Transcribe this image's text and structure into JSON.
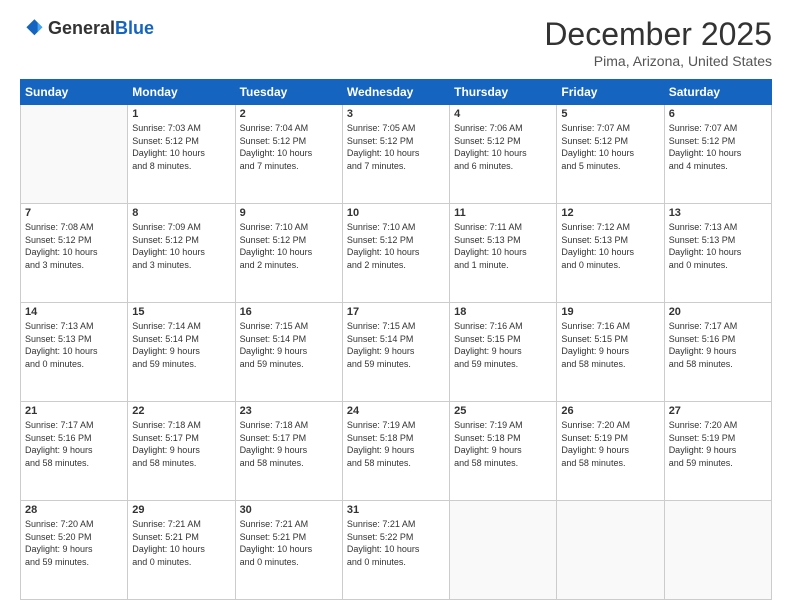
{
  "header": {
    "logo_general": "General",
    "logo_blue": "Blue",
    "month": "December 2025",
    "location": "Pima, Arizona, United States"
  },
  "days_of_week": [
    "Sunday",
    "Monday",
    "Tuesday",
    "Wednesday",
    "Thursday",
    "Friday",
    "Saturday"
  ],
  "weeks": [
    [
      {
        "num": "",
        "info": ""
      },
      {
        "num": "1",
        "info": "Sunrise: 7:03 AM\nSunset: 5:12 PM\nDaylight: 10 hours\nand 8 minutes."
      },
      {
        "num": "2",
        "info": "Sunrise: 7:04 AM\nSunset: 5:12 PM\nDaylight: 10 hours\nand 7 minutes."
      },
      {
        "num": "3",
        "info": "Sunrise: 7:05 AM\nSunset: 5:12 PM\nDaylight: 10 hours\nand 7 minutes."
      },
      {
        "num": "4",
        "info": "Sunrise: 7:06 AM\nSunset: 5:12 PM\nDaylight: 10 hours\nand 6 minutes."
      },
      {
        "num": "5",
        "info": "Sunrise: 7:07 AM\nSunset: 5:12 PM\nDaylight: 10 hours\nand 5 minutes."
      },
      {
        "num": "6",
        "info": "Sunrise: 7:07 AM\nSunset: 5:12 PM\nDaylight: 10 hours\nand 4 minutes."
      }
    ],
    [
      {
        "num": "7",
        "info": "Sunrise: 7:08 AM\nSunset: 5:12 PM\nDaylight: 10 hours\nand 3 minutes."
      },
      {
        "num": "8",
        "info": "Sunrise: 7:09 AM\nSunset: 5:12 PM\nDaylight: 10 hours\nand 3 minutes."
      },
      {
        "num": "9",
        "info": "Sunrise: 7:10 AM\nSunset: 5:12 PM\nDaylight: 10 hours\nand 2 minutes."
      },
      {
        "num": "10",
        "info": "Sunrise: 7:10 AM\nSunset: 5:12 PM\nDaylight: 10 hours\nand 2 minutes."
      },
      {
        "num": "11",
        "info": "Sunrise: 7:11 AM\nSunset: 5:13 PM\nDaylight: 10 hours\nand 1 minute."
      },
      {
        "num": "12",
        "info": "Sunrise: 7:12 AM\nSunset: 5:13 PM\nDaylight: 10 hours\nand 0 minutes."
      },
      {
        "num": "13",
        "info": "Sunrise: 7:13 AM\nSunset: 5:13 PM\nDaylight: 10 hours\nand 0 minutes."
      }
    ],
    [
      {
        "num": "14",
        "info": "Sunrise: 7:13 AM\nSunset: 5:13 PM\nDaylight: 10 hours\nand 0 minutes."
      },
      {
        "num": "15",
        "info": "Sunrise: 7:14 AM\nSunset: 5:14 PM\nDaylight: 9 hours\nand 59 minutes."
      },
      {
        "num": "16",
        "info": "Sunrise: 7:15 AM\nSunset: 5:14 PM\nDaylight: 9 hours\nand 59 minutes."
      },
      {
        "num": "17",
        "info": "Sunrise: 7:15 AM\nSunset: 5:14 PM\nDaylight: 9 hours\nand 59 minutes."
      },
      {
        "num": "18",
        "info": "Sunrise: 7:16 AM\nSunset: 5:15 PM\nDaylight: 9 hours\nand 59 minutes."
      },
      {
        "num": "19",
        "info": "Sunrise: 7:16 AM\nSunset: 5:15 PM\nDaylight: 9 hours\nand 58 minutes."
      },
      {
        "num": "20",
        "info": "Sunrise: 7:17 AM\nSunset: 5:16 PM\nDaylight: 9 hours\nand 58 minutes."
      }
    ],
    [
      {
        "num": "21",
        "info": "Sunrise: 7:17 AM\nSunset: 5:16 PM\nDaylight: 9 hours\nand 58 minutes."
      },
      {
        "num": "22",
        "info": "Sunrise: 7:18 AM\nSunset: 5:17 PM\nDaylight: 9 hours\nand 58 minutes."
      },
      {
        "num": "23",
        "info": "Sunrise: 7:18 AM\nSunset: 5:17 PM\nDaylight: 9 hours\nand 58 minutes."
      },
      {
        "num": "24",
        "info": "Sunrise: 7:19 AM\nSunset: 5:18 PM\nDaylight: 9 hours\nand 58 minutes."
      },
      {
        "num": "25",
        "info": "Sunrise: 7:19 AM\nSunset: 5:18 PM\nDaylight: 9 hours\nand 58 minutes."
      },
      {
        "num": "26",
        "info": "Sunrise: 7:20 AM\nSunset: 5:19 PM\nDaylight: 9 hours\nand 58 minutes."
      },
      {
        "num": "27",
        "info": "Sunrise: 7:20 AM\nSunset: 5:19 PM\nDaylight: 9 hours\nand 59 minutes."
      }
    ],
    [
      {
        "num": "28",
        "info": "Sunrise: 7:20 AM\nSunset: 5:20 PM\nDaylight: 9 hours\nand 59 minutes."
      },
      {
        "num": "29",
        "info": "Sunrise: 7:21 AM\nSunset: 5:21 PM\nDaylight: 10 hours\nand 0 minutes."
      },
      {
        "num": "30",
        "info": "Sunrise: 7:21 AM\nSunset: 5:21 PM\nDaylight: 10 hours\nand 0 minutes."
      },
      {
        "num": "31",
        "info": "Sunrise: 7:21 AM\nSunset: 5:22 PM\nDaylight: 10 hours\nand 0 minutes."
      },
      {
        "num": "",
        "info": ""
      },
      {
        "num": "",
        "info": ""
      },
      {
        "num": "",
        "info": ""
      }
    ]
  ]
}
